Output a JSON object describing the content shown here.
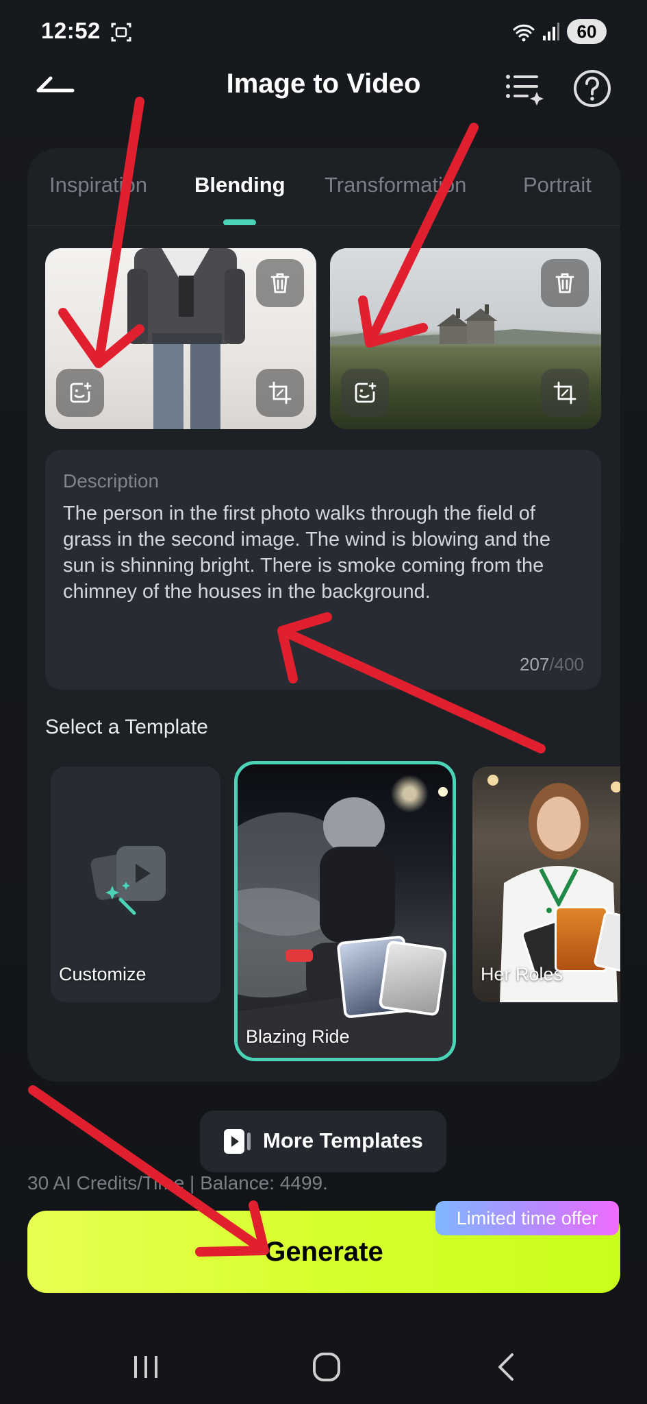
{
  "status_bar": {
    "time": "12:52",
    "battery": "60",
    "icons": [
      "screenshot-icon",
      "wifi-icon",
      "signal-icon"
    ]
  },
  "header": {
    "title": "Image to Video",
    "icons": [
      "back-icon",
      "history-icon",
      "help-icon"
    ]
  },
  "tabs": [
    {
      "label": "Inspiration",
      "active": false
    },
    {
      "label": "Blending",
      "active": true
    },
    {
      "label": "Transformation",
      "active": false
    },
    {
      "label": "Portrait",
      "active": false
    }
  ],
  "photos": [
    {
      "subject": "man in jacket",
      "buttons": [
        "delete-icon",
        "edit-image-icon",
        "crop-icon"
      ]
    },
    {
      "subject": "field with houses",
      "buttons": [
        "delete-icon",
        "edit-image-icon",
        "crop-icon"
      ]
    }
  ],
  "description": {
    "label": "Description",
    "text": "The person in the first photo walks through the field of grass in the second image. The wind is blowing and the sun is shinning bright. There is smoke coming from the chimney of the houses in the background.",
    "count": "207",
    "max": "/400"
  },
  "templates": {
    "heading": "Select a Template",
    "items": [
      {
        "label": "Customize",
        "selected": false
      },
      {
        "label": "Blazing Ride",
        "selected": true
      },
      {
        "label": "Her Roles",
        "selected": false
      }
    ],
    "more_label": "More Templates"
  },
  "credits": "30 AI Credits/Time | Balance: 4499.",
  "generate": {
    "label": "Generate",
    "badge": "Limited time offer"
  },
  "colors": {
    "accent": "#4ad3b7",
    "generate": "#d6ff2e",
    "annotation_arrow": "#e0202e"
  },
  "nav_bar": [
    "recents-icon",
    "home-icon",
    "back-nav-icon"
  ]
}
